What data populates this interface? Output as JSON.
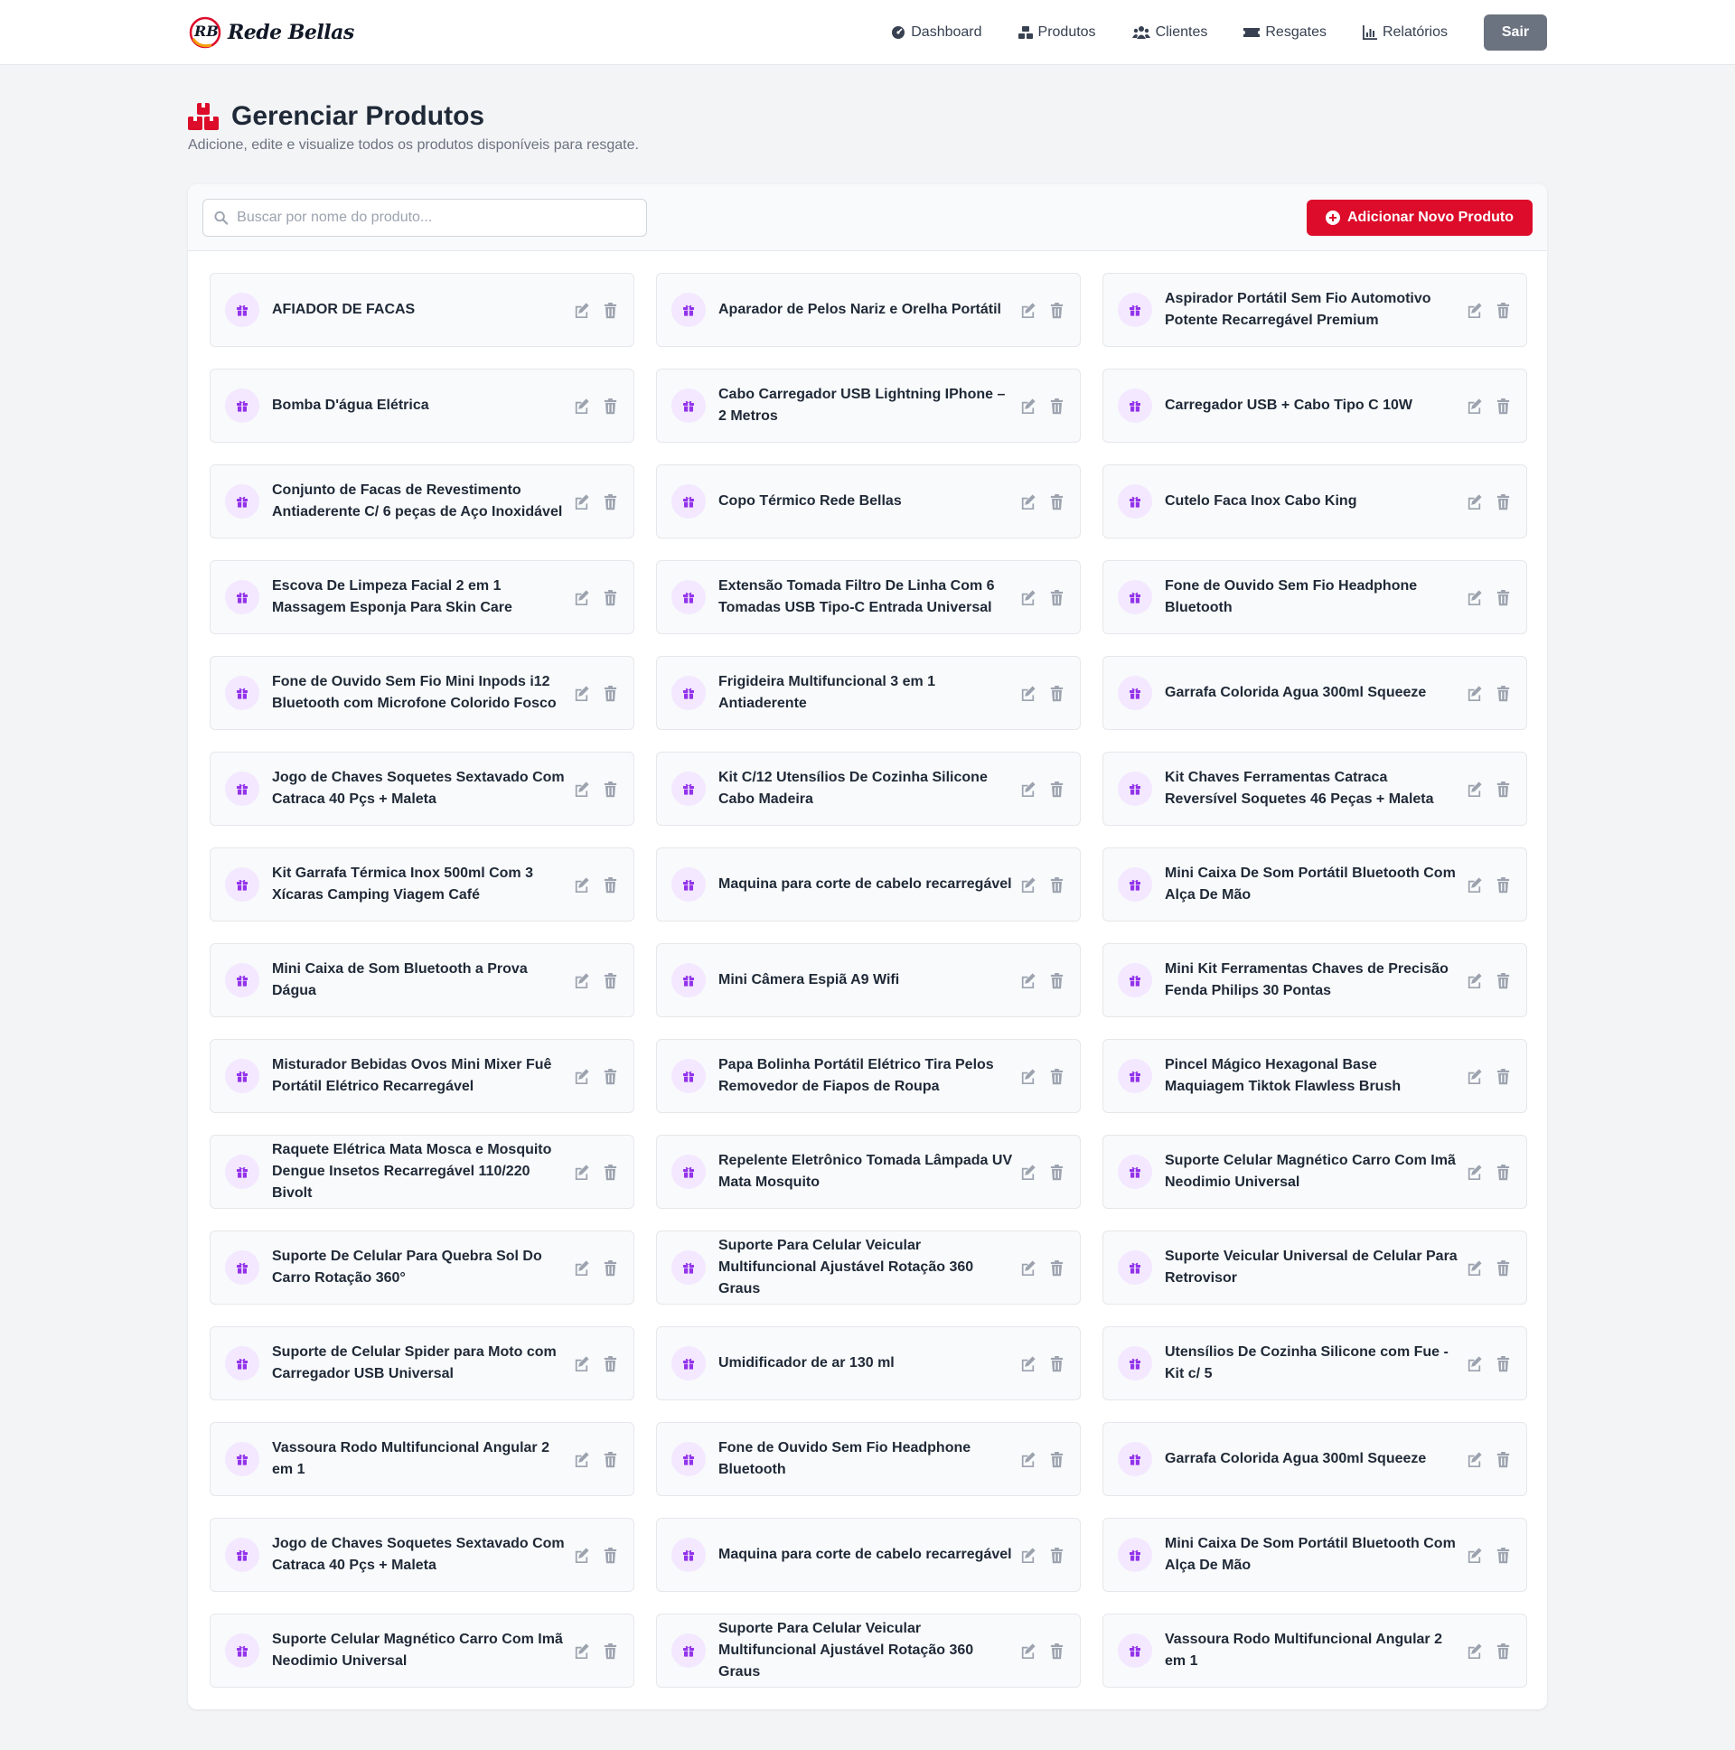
{
  "brand": {
    "name": "Rede Bellas",
    "logo_text": "RB"
  },
  "nav": {
    "items": [
      {
        "label": "Dashboard",
        "icon": "dashboard-icon"
      },
      {
        "label": "Produtos",
        "icon": "boxes-icon"
      },
      {
        "label": "Clientes",
        "icon": "users-icon"
      },
      {
        "label": "Resgates",
        "icon": "ticket-icon"
      },
      {
        "label": "Relatórios",
        "icon": "chart-icon"
      }
    ],
    "logout_label": "Sair"
  },
  "header": {
    "title": "Gerenciar Produtos",
    "subtitle": "Adicione, edite e visualize todos os produtos disponíveis para resgate."
  },
  "toolbar": {
    "search_placeholder": "Buscar por nome do produto...",
    "add_label": "Adicionar Novo Produto"
  },
  "colors": {
    "accent": "#dc0c2a",
    "icon_purple": "#9333ea",
    "icon_bg": "#f3e8ff"
  },
  "products": [
    "AFIADOR DE FACAS",
    "Aparador de Pelos Nariz e Orelha Portátil",
    "Aspirador Portátil Sem Fio Automotivo Potente Recarregável Premium",
    "Bomba D'água Elétrica",
    "Cabo Carregador USB Lightning IPhone – 2 Metros",
    "Carregador USB + Cabo Tipo C 10W",
    "Conjunto de Facas de Revestimento Antiaderente C/ 6 peças de Aço Inoxidável",
    "Copo Térmico Rede Bellas",
    "Cutelo Faca Inox Cabo King",
    "Escova De Limpeza Facial 2 em 1 Massagem Esponja Para Skin Care",
    "Extensão Tomada Filtro De Linha Com 6 Tomadas USB Tipo-C Entrada Universal",
    "Fone de Ouvido Sem Fio Headphone Bluetooth",
    "Fone de Ouvido Sem Fio Mini Inpods i12 Bluetooth com Microfone Colorido Fosco",
    "Frigideira Multifuncional 3 em 1 Antiaderente",
    "Garrafa Colorida Agua 300ml Squeeze",
    "Jogo de Chaves Soquetes Sextavado Com Catraca 40 Pçs + Maleta",
    "Kit C/12 Utensílios De Cozinha Silicone Cabo Madeira",
    "Kit Chaves Ferramentas Catraca Reversível Soquetes 46 Peças + Maleta",
    "Kit Garrafa Térmica Inox 500ml Com 3 Xícaras Camping Viagem Café",
    "Maquina para corte de cabelo recarregável",
    "Mini Caixa De Som Portátil Bluetooth Com Alça De Mão",
    "Mini Caixa de Som Bluetooth a Prova Dágua",
    "Mini Câmera Espiã A9 Wifi",
    "Mini Kit Ferramentas Chaves de Precisão Fenda Philips 30 Pontas",
    "Misturador Bebidas Ovos Mini Mixer Fuê Portátil Elétrico Recarregável",
    "Papa Bolinha Portátil Elétrico Tira Pelos Removedor de Fiapos de Roupa",
    "Pincel Mágico Hexagonal Base Maquiagem Tiktok Flawless Brush",
    "Raquete Elétrica Mata Mosca e Mosquito Dengue Insetos Recarregável 110/220 Bivolt",
    "Repelente Eletrônico Tomada Lâmpada UV Mata Mosquito",
    "Suporte Celular Magnético Carro Com Imã Neodimio Universal",
    "Suporte De Celular Para Quebra Sol Do Carro Rotação 360°",
    "Suporte Para Celular Veicular Multifuncional Ajustável Rotação 360 Graus",
    "Suporte Veicular Universal de Celular Para Retrovisor",
    "Suporte de Celular Spider para Moto com Carregador USB Universal",
    "Umidificador de ar 130 ml",
    "Utensílios De Cozinha Silicone com Fue - Kit c/ 5",
    "Vassoura Rodo Multifuncional Angular 2 em 1",
    "Fone de Ouvido Sem Fio Headphone Bluetooth",
    "Garrafa Colorida Agua 300ml Squeeze",
    "Jogo de Chaves Soquetes Sextavado Com Catraca 40 Pçs + Maleta",
    "Maquina para corte de cabelo recarregável",
    "Mini Caixa De Som Portátil Bluetooth Com Alça De Mão",
    "Suporte Celular Magnético Carro Com Imã Neodimio Universal",
    "Suporte Para Celular Veicular Multifuncional Ajustável Rotação 360 Graus",
    "Vassoura Rodo Multifuncional Angular 2 em 1"
  ]
}
